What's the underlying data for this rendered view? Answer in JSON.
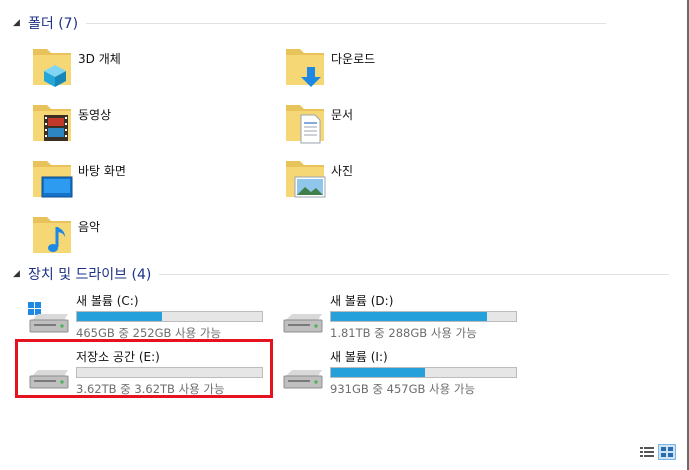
{
  "folders_section": {
    "title": "폴더 (7)"
  },
  "folders": [
    {
      "label": "3D 개체",
      "icon": "3d-objects-icon"
    },
    {
      "label": "다운로드",
      "icon": "downloads-icon"
    },
    {
      "label": "동영상",
      "icon": "videos-icon"
    },
    {
      "label": "문서",
      "icon": "documents-icon"
    },
    {
      "label": "바탕 화면",
      "icon": "desktop-icon"
    },
    {
      "label": "사진",
      "icon": "pictures-icon"
    },
    {
      "label": "음악",
      "icon": "music-icon"
    }
  ],
  "drives_section": {
    "title": "장치 및 드라이브 (4)"
  },
  "drives": [
    {
      "label": "새 볼륨 (C:)",
      "space": "465GB 중 252GB 사용 가능",
      "used_fraction": 0.458,
      "bar_color": "#26a0da",
      "icon": "system-drive-icon"
    },
    {
      "label": "새 볼륨 (D:)",
      "space": "1.81TB 중 288GB 사용 가능",
      "used_fraction": 0.845,
      "bar_color": "#26a0da",
      "icon": "hard-drive-icon"
    },
    {
      "label": "저장소 공간 (E:)",
      "space": "3.62TB 중 3.62TB 사용 가능",
      "used_fraction": 0.0,
      "bar_color": "#26a0da",
      "icon": "hard-drive-icon"
    },
    {
      "label": "새 볼륨 (I:)",
      "space": "931GB 중 457GB 사용 가능",
      "used_fraction": 0.509,
      "bar_color": "#26a0da",
      "icon": "hard-drive-icon"
    }
  ],
  "colors": {
    "accent": "#26a0da",
    "highlight": "#e5121f",
    "section_title": "#1e3287"
  },
  "view_buttons": [
    {
      "icon": "details-view-icon",
      "active": false
    },
    {
      "icon": "large-icons-view-icon",
      "active": true
    }
  ]
}
